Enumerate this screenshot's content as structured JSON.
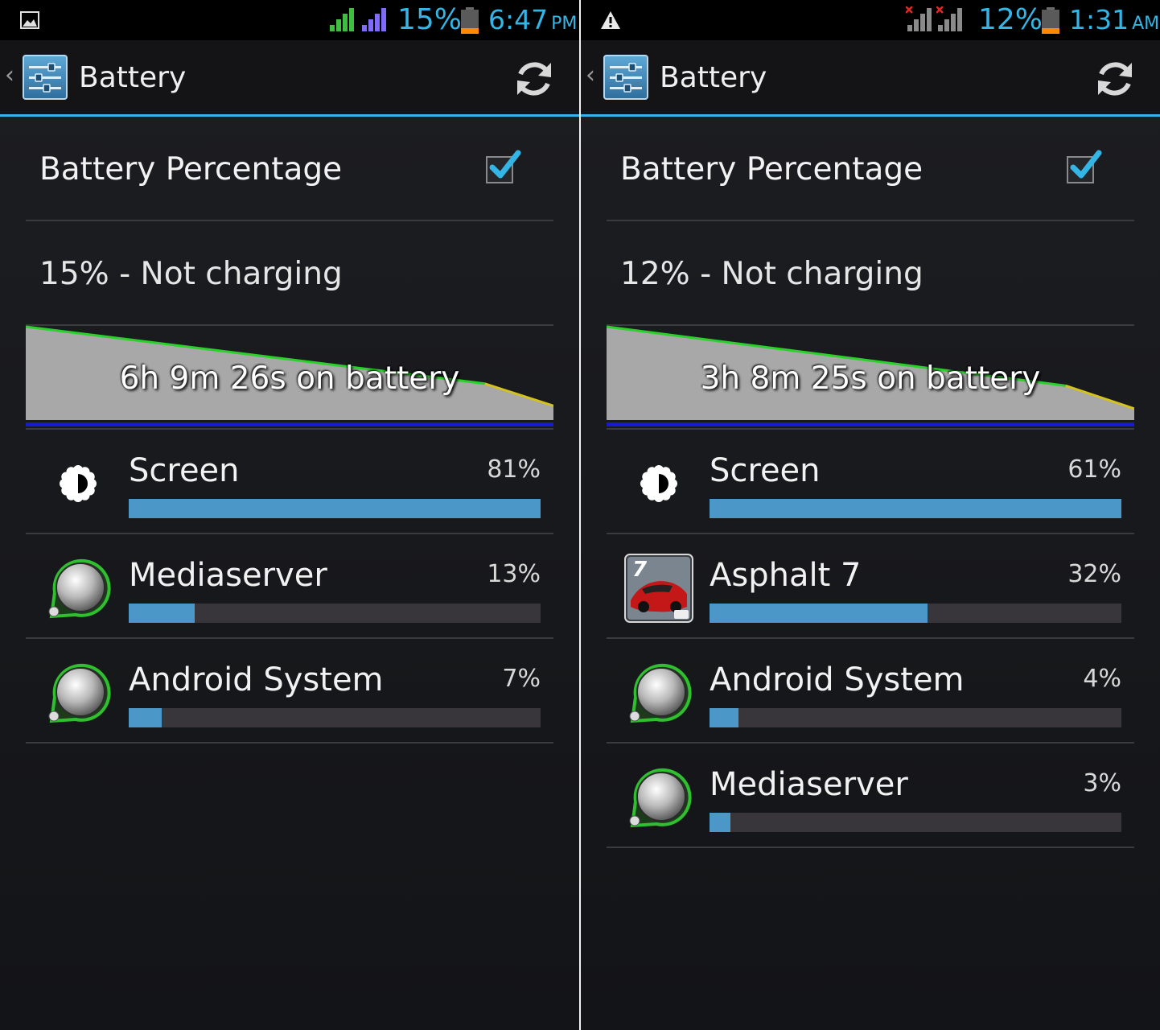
{
  "screens": [
    {
      "status": {
        "left_icon": "image-notification-icon",
        "battery_percent": "15%",
        "time": "6:47",
        "ampm": "PM",
        "signal_color_1": "#3fbf3f",
        "signal_color_2": "#7f6cff",
        "signal_crossed": false
      },
      "actionbar": {
        "title": "Battery",
        "app_icon": "settings-sliders-icon",
        "refresh_icon": "refresh-icon"
      },
      "battery_percentage_label": "Battery Percentage",
      "battery_percentage_checked": true,
      "charging_status": "15% - Not charging",
      "graph": {
        "label": "6h 9m 26s on battery",
        "level_start": 1.0,
        "level_end": 0.15
      },
      "usage": [
        {
          "name": "Screen",
          "percent": "81%",
          "value": 1.0,
          "icon": "brightness-icon"
        },
        {
          "name": "Mediaserver",
          "percent": "13%",
          "value": 0.16,
          "icon": "android-system-icon"
        },
        {
          "name": "Android System",
          "percent": "7%",
          "value": 0.08,
          "icon": "android-system-icon"
        }
      ]
    },
    {
      "status": {
        "left_icon": "warning-icon",
        "battery_percent": "12%",
        "time": "1:31",
        "ampm": "AM",
        "signal_color_1": "#8a8a8a",
        "signal_color_2": "#8a8a8a",
        "signal_crossed": true
      },
      "actionbar": {
        "title": "Battery",
        "app_icon": "settings-sliders-icon",
        "refresh_icon": "refresh-icon"
      },
      "battery_percentage_label": "Battery Percentage",
      "battery_percentage_checked": true,
      "charging_status": "12% - Not charging",
      "graph": {
        "label": "3h 8m 25s on battery",
        "level_start": 1.0,
        "level_end": 0.12
      },
      "usage": [
        {
          "name": "Screen",
          "percent": "61%",
          "value": 1.0,
          "icon": "brightness-icon"
        },
        {
          "name": "Asphalt 7",
          "percent": "32%",
          "value": 0.53,
          "icon": "asphalt-7-game-icon"
        },
        {
          "name": "Android System",
          "percent": "4%",
          "value": 0.07,
          "icon": "android-system-icon"
        },
        {
          "name": "Mediaserver",
          "percent": "3%",
          "value": 0.05,
          "icon": "android-system-icon"
        }
      ]
    }
  ],
  "colors": {
    "accent": "#33b5e5",
    "bar_fill": "#4b97c8",
    "bar_track": "#38353b",
    "graph_line": "#2bd12b",
    "graph_low": "#d4c21f",
    "graph_baseline": "#1a1acc"
  }
}
